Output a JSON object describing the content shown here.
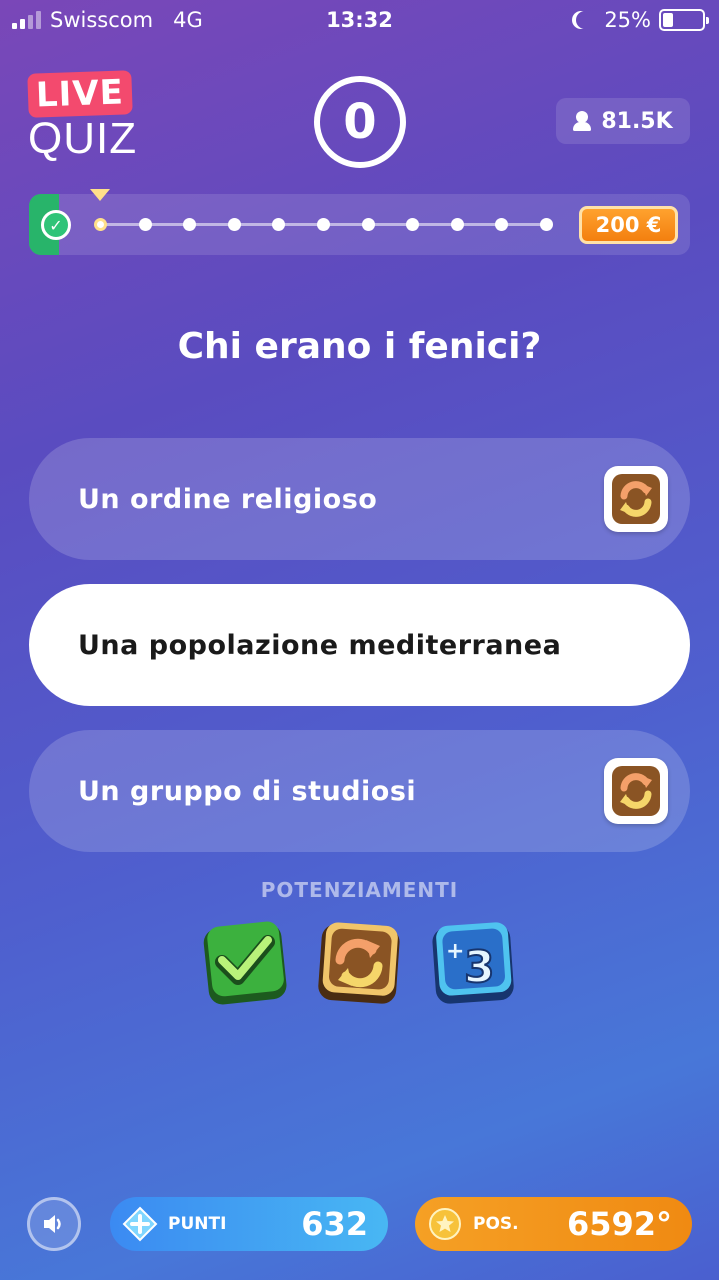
{
  "status_bar": {
    "carrier": "Swisscom",
    "network": "4G",
    "time": "13:32",
    "battery": "25%"
  },
  "header": {
    "logo_live": "LIVE",
    "logo_quiz": "QUIZ",
    "counter": "0",
    "viewers": "81.5K"
  },
  "progress": {
    "prize": "200 €",
    "steps_total": 11,
    "current_step": 1
  },
  "question": "Chi erano i fenici?",
  "answers": [
    {
      "text": "Un ordine religioso",
      "selected": false,
      "swap_icon": "swap-icon"
    },
    {
      "text": "Una popolazione mediterranea",
      "selected": true
    },
    {
      "text": "Un gruppo di studiosi",
      "selected": false,
      "swap_icon": "swap-icon"
    }
  ],
  "powerups": {
    "title": "POTENZIAMENTI",
    "items": [
      "check-powerup-icon",
      "swap-powerup-icon",
      "plus-three-powerup-icon"
    ]
  },
  "bottom": {
    "punti_label": "PUNTI",
    "punti_value": "632",
    "pos_label": "POS.",
    "pos_value": "6592°"
  },
  "colors": {
    "prize": "#f37f0f",
    "punti": "#3b8af2",
    "pos": "#f08a12",
    "check_green": "#28b46a"
  }
}
